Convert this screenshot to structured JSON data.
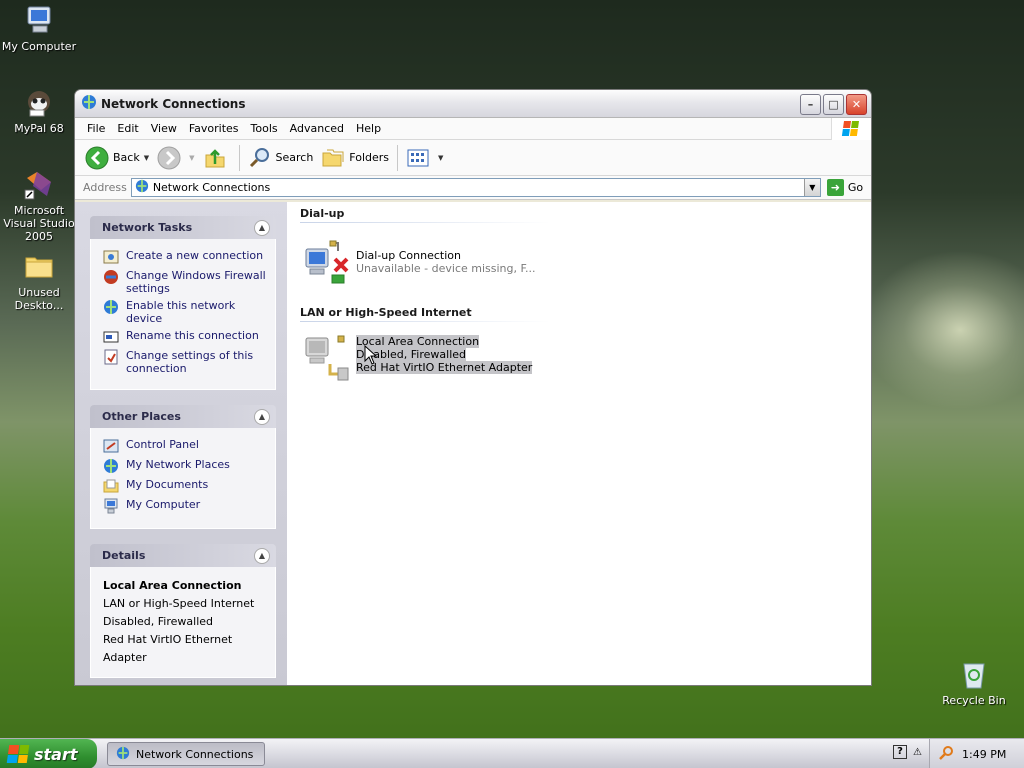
{
  "desktop": {
    "icons": [
      {
        "label": "My Computer"
      },
      {
        "label": "MyPal 68"
      },
      {
        "label": "Microsoft Visual Studio 2005"
      },
      {
        "label": "Unused Deskto..."
      },
      {
        "label": "Recycle Bin"
      }
    ]
  },
  "window": {
    "title": "Network Connections",
    "menu": [
      "File",
      "Edit",
      "View",
      "Favorites",
      "Tools",
      "Advanced",
      "Help"
    ],
    "toolbar": {
      "back": "Back",
      "search": "Search",
      "folders": "Folders"
    },
    "address": {
      "label": "Address",
      "value": "Network Connections",
      "go": "Go"
    }
  },
  "taskpane": {
    "network_tasks": {
      "title": "Network Tasks",
      "items": [
        {
          "label": "Create a new connection",
          "icon": "new-connection-icon"
        },
        {
          "label": "Change Windows Firewall settings",
          "icon": "firewall-icon"
        },
        {
          "label": "Enable this network device",
          "icon": "enable-device-icon"
        },
        {
          "label": "Rename this connection",
          "icon": "rename-icon"
        },
        {
          "label": "Change settings of this connection",
          "icon": "settings-icon"
        }
      ]
    },
    "other_places": {
      "title": "Other Places",
      "items": [
        {
          "label": "Control Panel",
          "icon": "control-panel-icon"
        },
        {
          "label": "My Network Places",
          "icon": "network-places-icon"
        },
        {
          "label": "My Documents",
          "icon": "my-documents-icon"
        },
        {
          "label": "My Computer",
          "icon": "my-computer-icon"
        }
      ]
    },
    "details": {
      "title": "Details",
      "name": "Local Area Connection",
      "lines": [
        "LAN or High-Speed Internet",
        "Disabled, Firewalled",
        "Red Hat VirtIO Ethernet Adapter"
      ]
    }
  },
  "main": {
    "groups": [
      {
        "title": "Dial-up",
        "connections": [
          {
            "name": "Dial-up Connection",
            "status": "Unavailable - device missing, F..."
          }
        ]
      },
      {
        "title": "LAN or High-Speed Internet",
        "connections": [
          {
            "name": "Local Area Connection",
            "status": "Disabled, Firewalled",
            "device": "Red Hat VirtIO Ethernet Adapter"
          }
        ]
      }
    ]
  },
  "taskbar": {
    "start": "start",
    "task": "Network Connections",
    "clock": "1:49 PM"
  }
}
